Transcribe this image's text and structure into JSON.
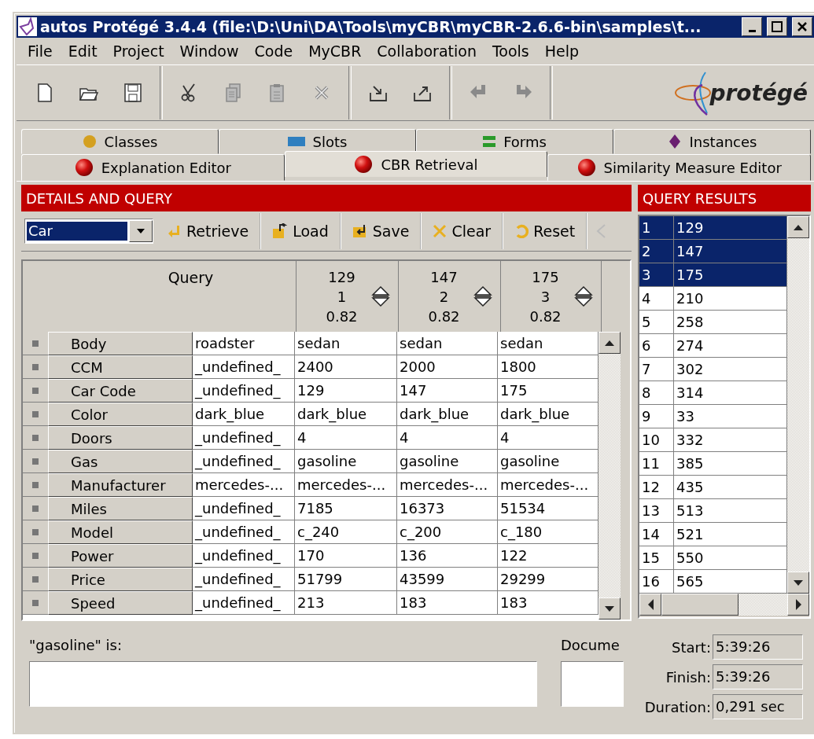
{
  "window": {
    "title": "autos  Protégé 3.4.4     (file:\\D:\\Uni\\DA\\Tools\\myCBR\\myCBR-2.6.6-bin\\samples\\t..."
  },
  "menu": [
    "File",
    "Edit",
    "Project",
    "Window",
    "Code",
    "MyCBR",
    "Collaboration",
    "Tools",
    "Help"
  ],
  "toolbar": [
    {
      "kind": "new",
      "disabled": false
    },
    {
      "kind": "open",
      "disabled": false
    },
    {
      "kind": "save",
      "disabled": false
    },
    {
      "kind": "sep"
    },
    {
      "kind": "cut",
      "disabled": false
    },
    {
      "kind": "copy",
      "disabled": true
    },
    {
      "kind": "paste",
      "disabled": true
    },
    {
      "kind": "delete",
      "disabled": true
    },
    {
      "kind": "sep"
    },
    {
      "kind": "import",
      "disabled": false
    },
    {
      "kind": "export",
      "disabled": false
    },
    {
      "kind": "sep"
    },
    {
      "kind": "undo",
      "disabled": true
    },
    {
      "kind": "redo",
      "disabled": true
    },
    {
      "kind": "sep"
    }
  ],
  "logo": {
    "text": "protégé"
  },
  "tabs_top": [
    {
      "label": "Classes",
      "kind": "classes",
      "selected": false
    },
    {
      "label": "Slots",
      "kind": "slots",
      "selected": false
    },
    {
      "label": "Forms",
      "kind": "forms",
      "selected": false
    },
    {
      "label": "Instances",
      "kind": "instances",
      "selected": false
    }
  ],
  "tabs": [
    {
      "label": "Explanation Editor",
      "selected": false
    },
    {
      "label": "CBR Retrieval",
      "selected": true
    },
    {
      "label": "Similarity Measure Editor",
      "selected": false
    }
  ],
  "query_panel": {
    "title": "DETAILS AND QUERY",
    "class_select": "Car",
    "buttons": [
      {
        "label": "Retrieve",
        "kind": "retrieve"
      },
      {
        "label": "Load",
        "kind": "load"
      },
      {
        "label": "Save",
        "kind": "save"
      },
      {
        "label": "Clear",
        "kind": "clear"
      },
      {
        "label": "Reset",
        "kind": "reset"
      }
    ],
    "query_header": "Query",
    "cases": [
      {
        "id": "129",
        "rank": "1",
        "score": "0.82"
      },
      {
        "id": "147",
        "rank": "2",
        "score": "0.82"
      },
      {
        "id": "175",
        "rank": "3",
        "score": "0.82"
      }
    ],
    "rows": [
      {
        "attribute": "Body",
        "query": "roadster",
        "values": [
          "sedan",
          "sedan",
          "sedan"
        ]
      },
      {
        "attribute": "CCM",
        "query": "_undefined_",
        "values": [
          "2400",
          "2000",
          "1800"
        ]
      },
      {
        "attribute": "Car Code",
        "query": "_undefined_",
        "values": [
          "129",
          "147",
          "175"
        ]
      },
      {
        "attribute": "Color",
        "query": "dark_blue",
        "values": [
          "dark_blue",
          "dark_blue",
          "dark_blue"
        ]
      },
      {
        "attribute": "Doors",
        "query": "_undefined_",
        "values": [
          "4",
          "4",
          "4"
        ]
      },
      {
        "attribute": "Gas",
        "query": "_undefined_",
        "values": [
          "gasoline",
          "gasoline",
          "gasoline"
        ]
      },
      {
        "attribute": "Manufacturer",
        "query": "mercedes-...",
        "values": [
          "mercedes-...",
          "mercedes-...",
          "mercedes-..."
        ]
      },
      {
        "attribute": "Miles",
        "query": "_undefined_",
        "values": [
          "7185",
          "16373",
          "51534"
        ]
      },
      {
        "attribute": "Model",
        "query": "_undefined_",
        "values": [
          "c_240",
          "c_200",
          "c_180"
        ]
      },
      {
        "attribute": "Power",
        "query": "_undefined_",
        "values": [
          "170",
          "136",
          "122"
        ]
      },
      {
        "attribute": "Price",
        "query": "_undefined_",
        "values": [
          "51799",
          "43599",
          "29299"
        ]
      },
      {
        "attribute": "Speed",
        "query": "_undefined_",
        "values": [
          "213",
          "183",
          "183"
        ]
      }
    ],
    "explanation_label": "\"gasoline\" is:",
    "documentation_label": "Docume"
  },
  "results_panel": {
    "title": "QUERY RESULTS",
    "rows": [
      {
        "index": "1",
        "value": "129",
        "selected": true
      },
      {
        "index": "2",
        "value": "147",
        "selected": true
      },
      {
        "index": "3",
        "value": "175",
        "selected": true
      },
      {
        "index": "4",
        "value": "210",
        "selected": false
      },
      {
        "index": "5",
        "value": "258",
        "selected": false
      },
      {
        "index": "6",
        "value": "274",
        "selected": false
      },
      {
        "index": "7",
        "value": "302",
        "selected": false
      },
      {
        "index": "8",
        "value": "314",
        "selected": false
      },
      {
        "index": "9",
        "value": "33",
        "selected": false
      },
      {
        "index": "10",
        "value": "332",
        "selected": false
      },
      {
        "index": "11",
        "value": "385",
        "selected": false
      },
      {
        "index": "12",
        "value": "435",
        "selected": false
      },
      {
        "index": "13",
        "value": "513",
        "selected": false
      },
      {
        "index": "14",
        "value": "521",
        "selected": false
      },
      {
        "index": "15",
        "value": "550",
        "selected": false
      },
      {
        "index": "16",
        "value": "565",
        "selected": false
      }
    ],
    "timing": [
      {
        "label": "Start:",
        "value": "5:39:26"
      },
      {
        "label": "Finish:",
        "value": "5:39:26"
      },
      {
        "label": "Duration:",
        "value": "0,291 sec"
      }
    ]
  }
}
